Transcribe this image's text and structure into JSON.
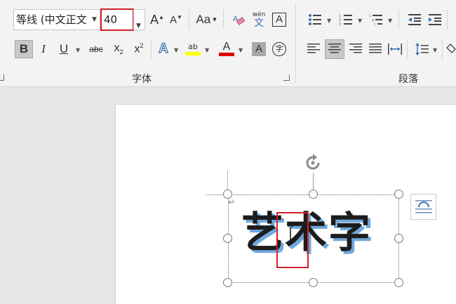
{
  "font": {
    "name": "等线 (中文正文",
    "size": "40",
    "grow_label": "A",
    "shrink_label": "A",
    "case_label": "Aa",
    "pinyin_top": "wén",
    "pinyin_bottom": "文",
    "border_label": "A",
    "bold_label": "B",
    "italic_label": "I",
    "underline_label": "U",
    "strike_label": "abc",
    "subscript_label": "x",
    "sub2": "2",
    "superscript_label": "x",
    "sup2": "2",
    "effects_label": "A",
    "highlight_label": "ab",
    "color_label": "A",
    "shade_label": "A",
    "enclose_label": "字",
    "group_label": "字体",
    "highlight_color": "#ffff00",
    "font_color": "#e00000"
  },
  "paragraph": {
    "group_label": "段落"
  },
  "document": {
    "text": "艺术字",
    "chars": [
      "艺",
      "术",
      "字"
    ],
    "return_mark": "↵"
  },
  "colors": {
    "highlight_box": "#d4202a",
    "text_shadow": "#6fa8dc"
  }
}
